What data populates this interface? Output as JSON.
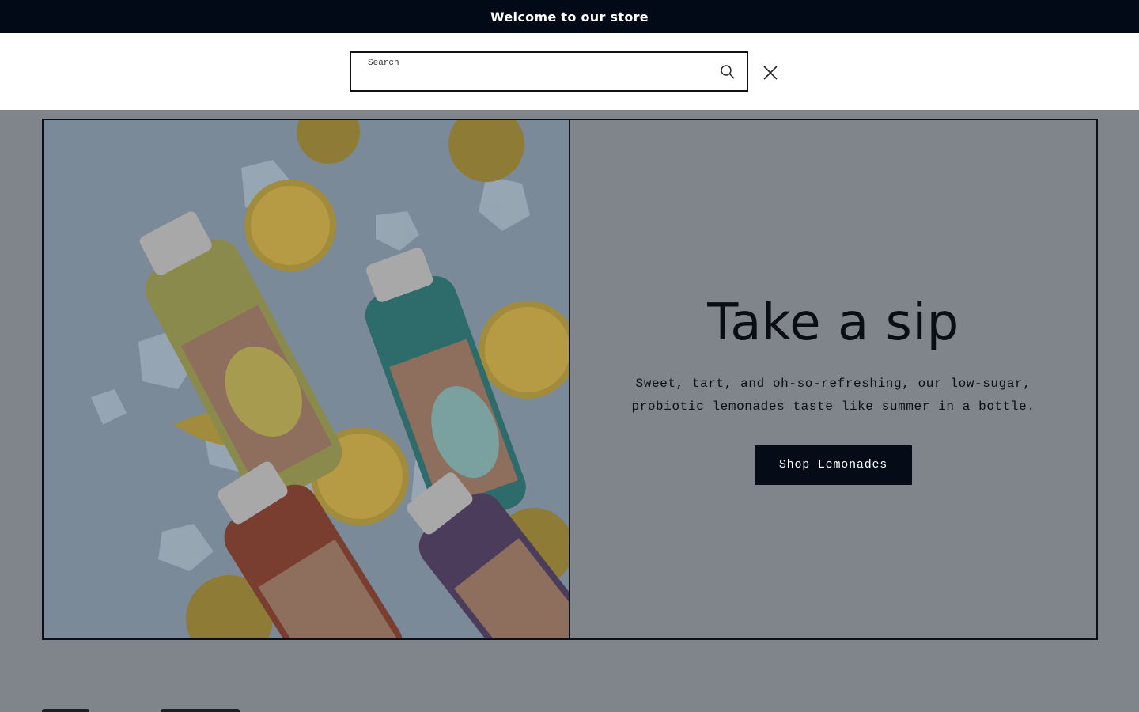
{
  "announcement": {
    "text": "Welcome to our store"
  },
  "search": {
    "label": "Search",
    "placeholder": "Search",
    "value": "",
    "submit_icon": "search-icon",
    "close_icon": "close-icon"
  },
  "hero": {
    "title": "Take a sip",
    "description": "Sweet, tart, and oh-so-refreshing, our low-sugar, probiotic lemonades taste like summer in a bottle.",
    "cta_label": "Shop Lemonades",
    "image": {
      "bottles": [
        "Spicy Lemonade",
        "Blue Lemonade",
        "Strawberry Lemonade",
        "Lavender Lemonade"
      ]
    }
  },
  "colors": {
    "announcement_bg": "#020a18",
    "overlay": "#80858b",
    "button_bg": "#050b17"
  }
}
